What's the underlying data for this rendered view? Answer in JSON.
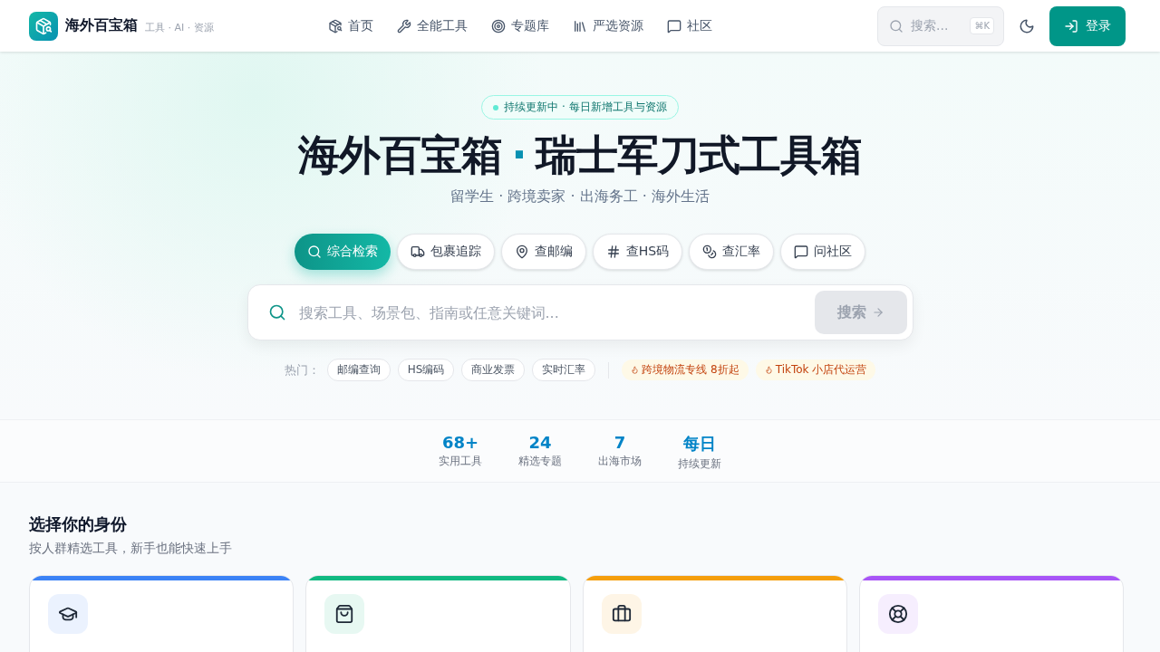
{
  "header": {
    "brand": "海外百宝箱",
    "tagline": "工具 · AI · 资源",
    "nav": [
      {
        "label": "首页"
      },
      {
        "label": "全能工具"
      },
      {
        "label": "专题库"
      },
      {
        "label": "严选资源"
      },
      {
        "label": "社区"
      }
    ],
    "search": {
      "placeholder": "搜索...",
      "shortcut": "⌘K"
    },
    "login": "登录"
  },
  "hero": {
    "badge": "持续更新中 · 每日新增工具与资源",
    "title_left": "海外百宝箱",
    "title_dot": "·",
    "title_right": "瑞士军刀式工具箱",
    "subtitle": "留学生 · 跨境卖家 · 出海务工 · 海外生活",
    "modes": [
      {
        "label": "综合检索",
        "selected": true
      },
      {
        "label": "包裹追踪",
        "selected": false
      },
      {
        "label": "查邮编",
        "selected": false
      },
      {
        "label": "查HS码",
        "selected": false
      },
      {
        "label": "查汇率",
        "selected": false
      },
      {
        "label": "问社区",
        "selected": false
      }
    ],
    "search": {
      "placeholder": "搜索工具、场景包、指南或任意关键词...",
      "button": "搜索"
    },
    "hot_label": "热门：",
    "hot": [
      {
        "kind": "plain",
        "label": "邮编查询"
      },
      {
        "kind": "plain",
        "label": "HS编码"
      },
      {
        "kind": "plain",
        "label": "商业发票"
      },
      {
        "kind": "plain",
        "label": "实时汇率"
      },
      {
        "kind": "promo",
        "label": "跨境物流专线 8折起"
      },
      {
        "kind": "promo",
        "label": "TikTok 小店代运营"
      }
    ]
  },
  "stats": [
    {
      "value": "68+",
      "label": "实用工具"
    },
    {
      "value": "24",
      "label": "精选专题"
    },
    {
      "value": "7",
      "label": "出海市场"
    },
    {
      "value": "每日",
      "label": "持续更新"
    }
  ],
  "section": {
    "title": "选择你的身份",
    "subtitle": "按人群精选工具，新手也能快速上手"
  },
  "cards": [
    {
      "color": "#3b82f6"
    },
    {
      "color": "#10b981"
    },
    {
      "color": "#f59e0b"
    },
    {
      "color": "#a855f7"
    }
  ]
}
